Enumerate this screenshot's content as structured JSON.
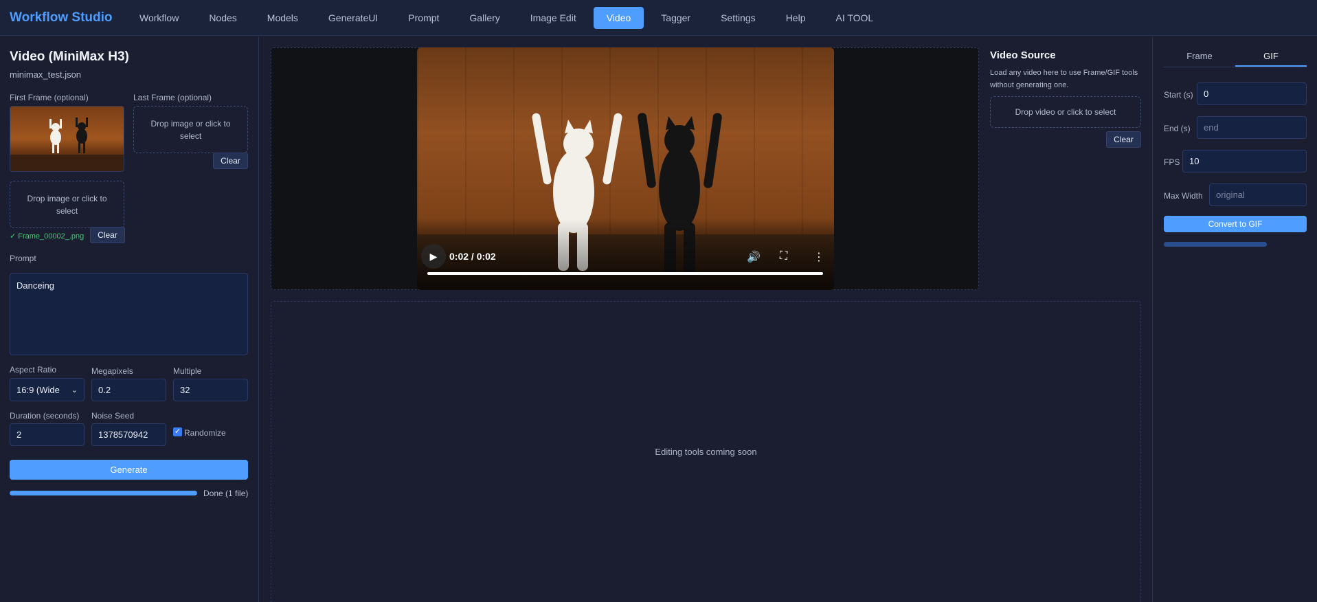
{
  "app": {
    "brand": "Workflow Studio",
    "nav": [
      "Workflow",
      "Nodes",
      "Models",
      "GenerateUI",
      "Prompt",
      "Gallery",
      "Image Edit",
      "Video",
      "Tagger",
      "Settings",
      "Help",
      "AI TOOL"
    ],
    "active_nav": "Video"
  },
  "left": {
    "title": "Video (MiniMax H3)",
    "subtitle": "minimax_test.json",
    "first_frame_label": "First Frame (optional)",
    "last_frame_label": "Last Frame (optional)",
    "drop_image_text": "Drop image or click to select",
    "clear_label": "Clear",
    "loaded_file": "✓ Frame_00002_.png",
    "prompt_label": "Prompt",
    "prompt_value": "Danceing",
    "aspect_ratio_label": "Aspect Ratio",
    "aspect_ratio_value": "16:9 (Wide",
    "megapixels_label": "Megapixels",
    "megapixels_value": "0.2",
    "multiple_label": "Multiple",
    "multiple_value": "32",
    "duration_label": "Duration (seconds)",
    "duration_value": "2",
    "noise_seed_label": "Noise Seed",
    "noise_seed_value": "1378570942",
    "randomize_label": "Randomize",
    "randomize_checked": true,
    "generate_label": "Generate",
    "progress": 1.0,
    "progress_label": "Done (1 file)"
  },
  "player": {
    "time": "0:02 / 0:02",
    "progress": 1.0
  },
  "video_source": {
    "title": "Video Source",
    "description": "Load any video here to use Frame/GIF tools without generating one.",
    "drop_text": "Drop video or click to select",
    "clear_label": "Clear"
  },
  "editing": {
    "placeholder": "Editing tools coming soon"
  },
  "gif": {
    "tabs": [
      "Frame",
      "GIF"
    ],
    "active_tab": "GIF",
    "start_label": "Start (s)",
    "start_value": "0",
    "end_label": "End (s)",
    "end_placeholder": "end",
    "fps_label": "FPS",
    "fps_value": "10",
    "max_width_label": "Max Width",
    "max_width_placeholder": "original",
    "convert_label": "Convert to GIF"
  },
  "colors": {
    "accent": "#4f9dff",
    "background": "#1b1e31",
    "success": "#3fcf70"
  }
}
